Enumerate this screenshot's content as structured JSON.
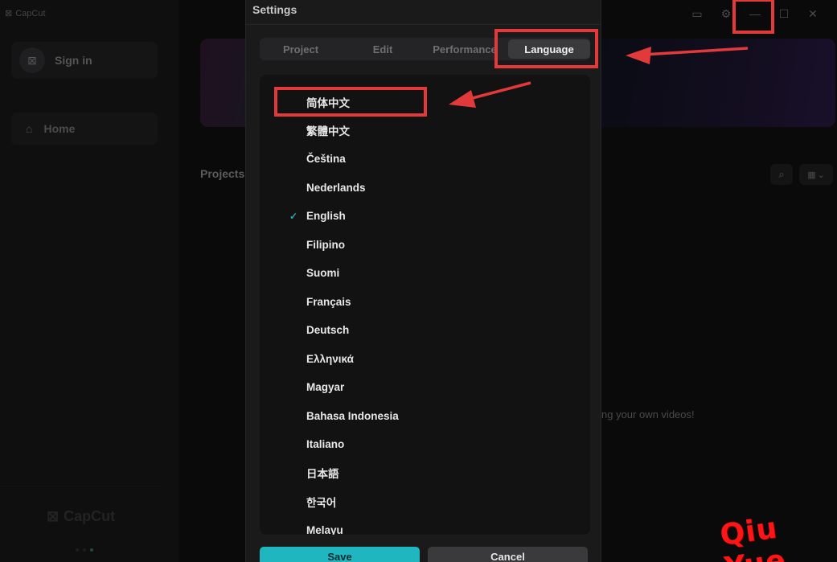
{
  "app": {
    "title": "CapCut",
    "sign_in": "Sign in",
    "home": "Home",
    "projects_title": "Projects",
    "empty_hint": "ng your own videos!",
    "side_logo": "CapCut"
  },
  "dialog": {
    "title": "Settings",
    "tabs": [
      "Project",
      "Edit",
      "Performance",
      "Language"
    ],
    "active_tab": "Language",
    "languages": [
      "简体中文",
      "繁體中文",
      "Čeština",
      "Nederlands",
      "English",
      "Filipino",
      "Suomi",
      "Français",
      "Deutsch",
      "Ελληνικά",
      "Magyar",
      "Bahasa Indonesia",
      "Italiano",
      "日本語",
      "한국어",
      "Melayu"
    ],
    "selected_language": "English",
    "save_label": "Save",
    "cancel_label": "Cancel"
  },
  "watermark": "Qiu  Yue",
  "colors": {
    "accent": "#1fb6c0",
    "highlight": "#e23a3a",
    "dialog_bg": "#1a1a1b"
  }
}
